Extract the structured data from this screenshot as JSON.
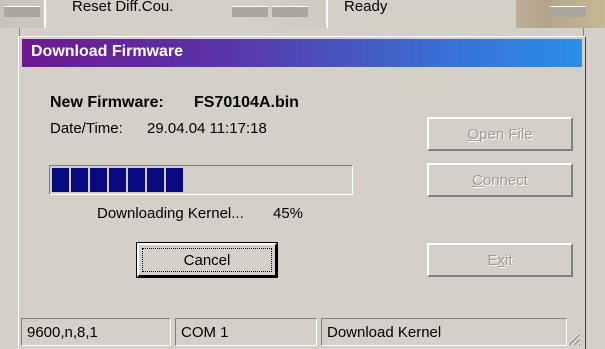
{
  "background": {
    "left_text": "Reset Diff.Cou.",
    "right_text": "Ready"
  },
  "dialog": {
    "title": "Download Firmware",
    "new_firmware_label": "New Firmware:",
    "new_firmware_value": "FS70104A.bin",
    "datetime_label": "Date/Time:",
    "datetime_value": "29.04.04 11:17:18",
    "progress_percent": 45,
    "progress_filled_blocks": 7,
    "progress_status": "Downloading Kernel...",
    "progress_percent_label": "45%",
    "buttons": {
      "cancel": "Cancel",
      "open_file_prefix": "",
      "open_file_accel": "O",
      "open_file_rest": "pen File",
      "connect_accel": "C",
      "connect_rest": "onnect",
      "exit_prefix": "E",
      "exit_accel": "x",
      "exit_rest": "it"
    },
    "status_bar": {
      "port_settings": "9600,n,8,1",
      "port": "COM 1",
      "state": "Download Kernel"
    }
  },
  "colors": {
    "title_gradient_start": "#6d1a8e",
    "title_gradient_end": "#2a8ee8",
    "progress_fill": "#0a0a80",
    "face": "#d4d0c8"
  }
}
